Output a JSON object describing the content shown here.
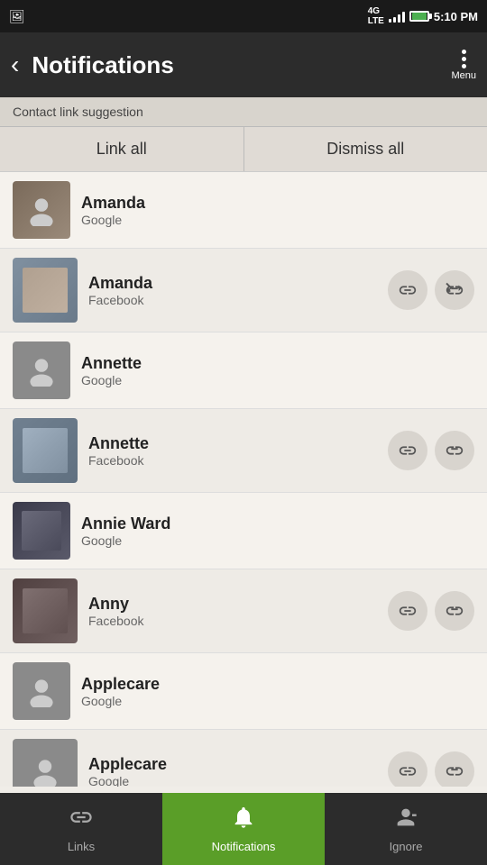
{
  "statusBar": {
    "carrier": "4G LTE",
    "time": "5:10 PM"
  },
  "header": {
    "back_label": "‹",
    "title": "Notifications",
    "menu_label": "Menu"
  },
  "suggestion_bar": {
    "label": "Contact link suggestion"
  },
  "action_buttons": {
    "link_all": "Link all",
    "dismiss_all": "Dismiss all"
  },
  "contacts": [
    {
      "id": 1,
      "main_name": "Amanda",
      "main_source": "Google",
      "main_avatar_type": "photo1",
      "sub_name": "Amanda",
      "sub_source": "Facebook",
      "sub_avatar_type": "photo2"
    },
    {
      "id": 2,
      "main_name": "Annette",
      "main_source": "Google",
      "main_avatar_type": "placeholder",
      "sub_name": "Annette",
      "sub_source": "Facebook",
      "sub_avatar_type": "photo3"
    },
    {
      "id": 3,
      "main_name": "Annie Ward",
      "main_source": "Google",
      "main_avatar_type": "photo5",
      "sub_name": "Anny",
      "sub_source": "Facebook",
      "sub_avatar_type": "photo4"
    },
    {
      "id": 4,
      "main_name": "Applecare",
      "main_source": "Google",
      "main_avatar_type": "placeholder",
      "sub_name": "Applecare",
      "sub_source": "Google",
      "sub_avatar_type": "placeholder"
    }
  ],
  "bottomNav": {
    "links_label": "Links",
    "notifications_label": "Notifications",
    "ignore_label": "Ignore"
  }
}
